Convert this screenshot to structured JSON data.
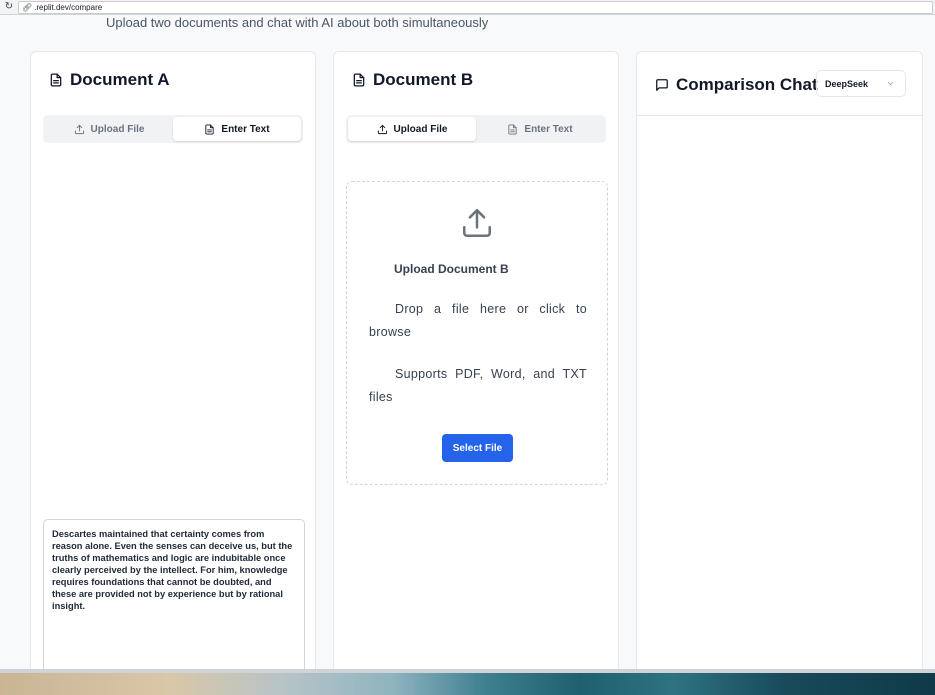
{
  "browser": {
    "url": ".replit.dev/compare"
  },
  "page": {
    "subtitle": "Upload two documents and chat with AI about both simultaneously"
  },
  "doc_a": {
    "title": "Document A",
    "tabs": {
      "upload": "Upload File",
      "text": "Enter Text",
      "active": "text"
    },
    "text": "Descartes maintained that certainty comes from reason alone. Even the senses can deceive us, but the truths of mathematics and logic are indubitable once clearly perceived by the intellect. For him, knowledge requires foundations that cannot be doubted, and these are provided not by experience but by rational insight."
  },
  "doc_b": {
    "title": "Document B",
    "tabs": {
      "upload": "Upload File",
      "text": "Enter Text",
      "active": "upload"
    },
    "dropzone": {
      "title": "Upload Document B",
      "description": "Drop a file here or click to browse",
      "supports": "Supports PDF, Word, and TXT files",
      "button": "Select File"
    }
  },
  "chat": {
    "title": "Comparison Chat",
    "model": "DeepSeek"
  },
  "colors": {
    "primary": "#2563eb",
    "border": "#e5e7eb"
  },
  "icons": {
    "doc_title": "file-text-icon",
    "upload": "upload-icon",
    "text": "file-text-icon",
    "chat": "message-square-icon",
    "chevron": "chevron-down-icon"
  }
}
